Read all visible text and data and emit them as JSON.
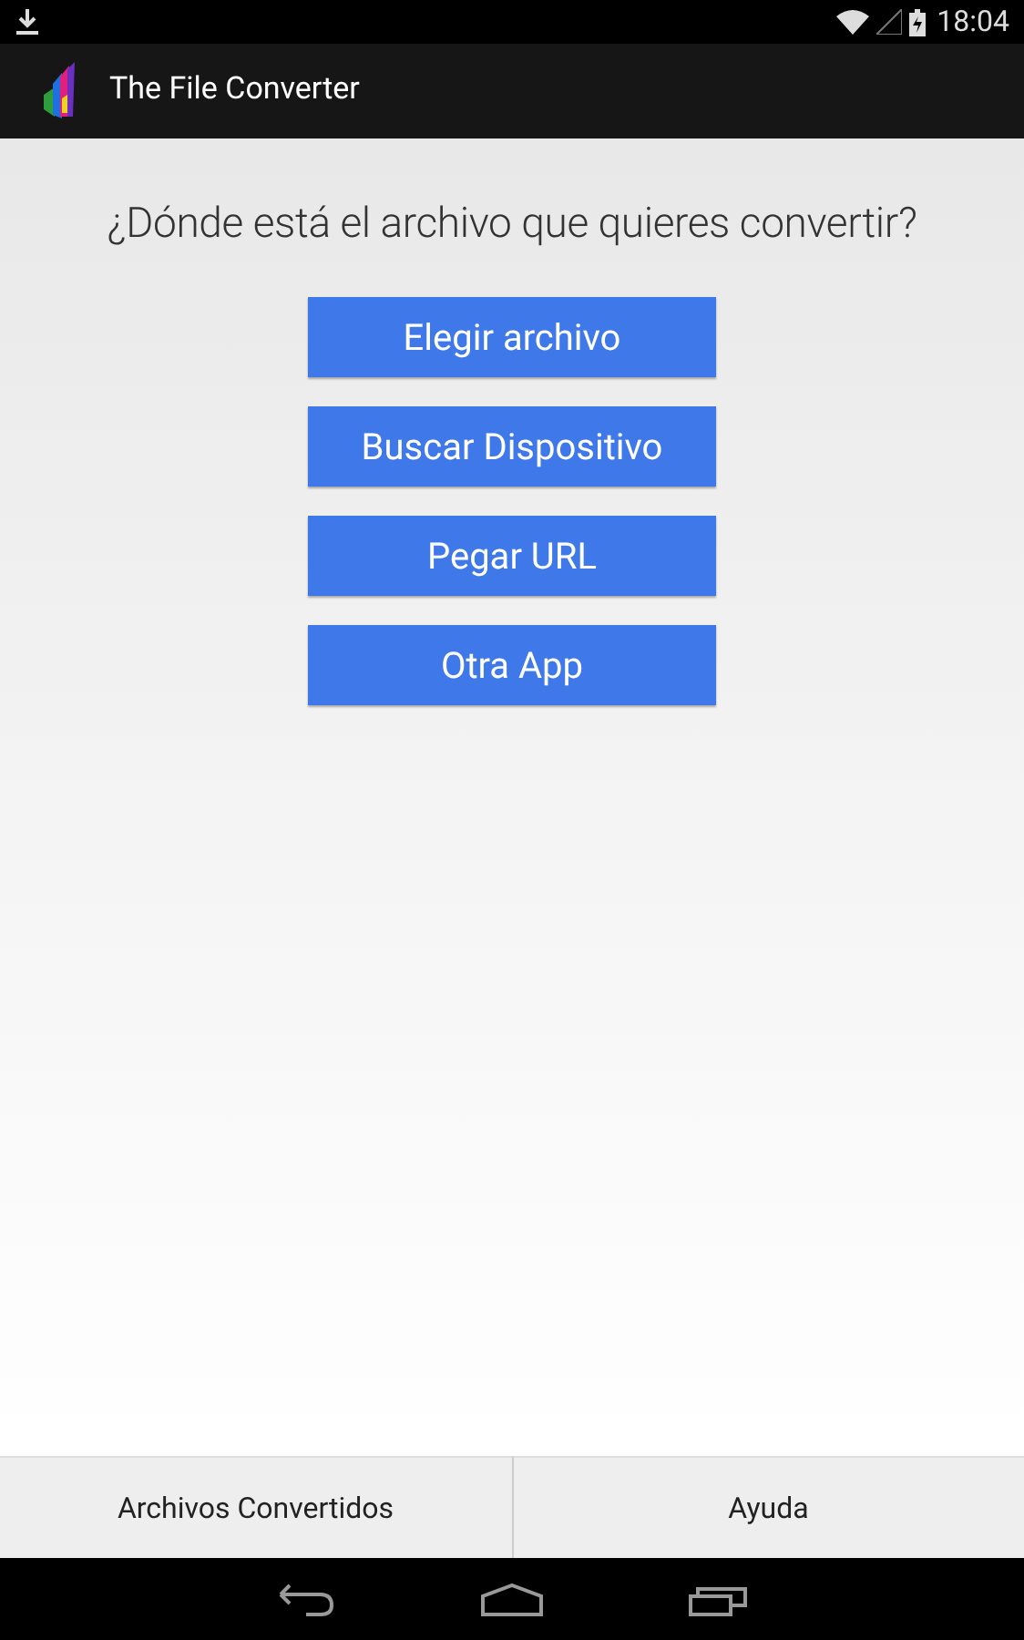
{
  "status_bar": {
    "time": "18:04"
  },
  "app_bar": {
    "title": "The File Converter"
  },
  "question": "¿Dónde está el archivo que quieres convertir?",
  "buttons": [
    "Elegir archivo",
    "Buscar Dispositivo",
    "Pegar URL",
    "Otra App"
  ],
  "bottom_tabs": [
    "Archivos Convertidos",
    "Ayuda"
  ]
}
